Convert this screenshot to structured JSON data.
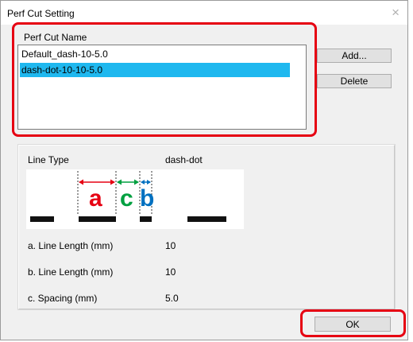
{
  "window": {
    "title": "Perf Cut Setting",
    "close_glyph": "×"
  },
  "perf_cut_name": {
    "label": "Perf Cut Name",
    "items": [
      "Default_dash-10-5.0",
      "dash-dot-10-10-5.0"
    ],
    "selected_index": 1
  },
  "buttons": {
    "add": "Add...",
    "delete": "Delete",
    "ok": "OK"
  },
  "line_type": {
    "label": "Line Type",
    "value": "dash-dot",
    "diagram": {
      "a": "a",
      "b": "b",
      "c": "c",
      "colors": {
        "a": "#e60012",
        "b": "#0070c0",
        "c": "#00a040"
      }
    }
  },
  "params": [
    {
      "label": "a. Line Length (mm)",
      "value": "10"
    },
    {
      "label": "b. Line Length (mm)",
      "value": "10"
    },
    {
      "label": "c. Spacing (mm)",
      "value": "5.0"
    }
  ],
  "colors": {
    "highlight": "#e60012",
    "selection": "#1fb8ef"
  }
}
